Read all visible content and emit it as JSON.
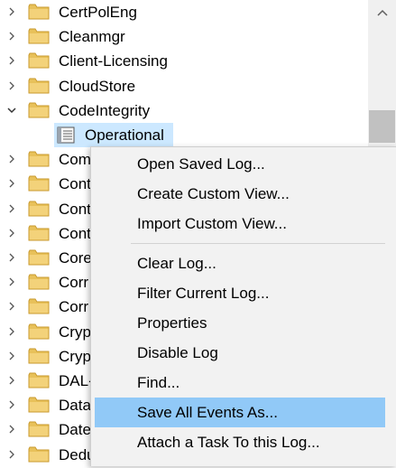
{
  "tree": {
    "items": [
      {
        "label": "CertPolEng",
        "expanded": false
      },
      {
        "label": "Cleanmgr",
        "expanded": false
      },
      {
        "label": "Client-Licensing",
        "expanded": false
      },
      {
        "label": "CloudStore",
        "expanded": false
      },
      {
        "label": "CodeIntegrity",
        "expanded": true
      },
      {
        "label": "Operational",
        "child": true,
        "selected": true
      },
      {
        "label": "Com",
        "expanded": false
      },
      {
        "label": "Cont",
        "expanded": false
      },
      {
        "label": "Cont",
        "expanded": false
      },
      {
        "label": "Cont",
        "expanded": false
      },
      {
        "label": "Core",
        "expanded": false
      },
      {
        "label": "Corr",
        "expanded": false
      },
      {
        "label": "Corr",
        "expanded": false
      },
      {
        "label": "Cryp",
        "expanded": false
      },
      {
        "label": "Cryp",
        "expanded": false
      },
      {
        "label": "DAL-",
        "expanded": false
      },
      {
        "label": "Data",
        "expanded": false
      },
      {
        "label": "Date",
        "expanded": false
      },
      {
        "label": "Dedu",
        "expanded": false
      }
    ]
  },
  "context_menu": {
    "groups": [
      [
        {
          "label": "Open Saved Log..."
        },
        {
          "label": "Create Custom View..."
        },
        {
          "label": "Import Custom View..."
        }
      ],
      [
        {
          "label": "Clear Log..."
        },
        {
          "label": "Filter Current Log..."
        },
        {
          "label": "Properties"
        },
        {
          "label": "Disable Log"
        },
        {
          "label": "Find..."
        },
        {
          "label": "Save All Events As...",
          "highlighted": true
        },
        {
          "label": "Attach a Task To this Log..."
        }
      ]
    ]
  },
  "colors": {
    "selection": "#cce8ff",
    "menu_highlight": "#91c9f7",
    "folder": "#e8c15a"
  }
}
